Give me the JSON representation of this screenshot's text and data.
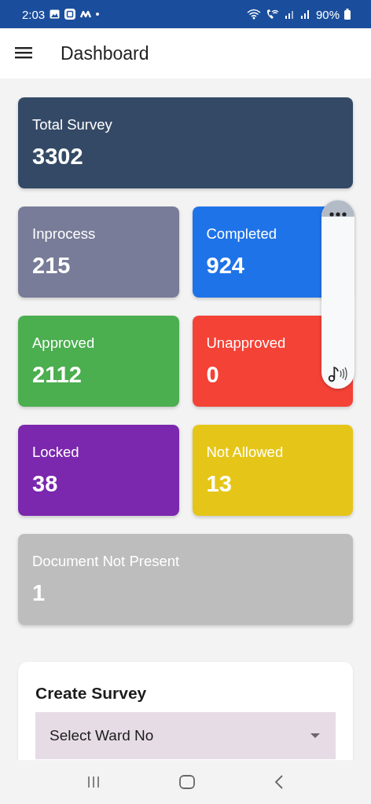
{
  "status_bar": {
    "time": "2:03",
    "battery": "90%"
  },
  "app_bar": {
    "title": "Dashboard"
  },
  "stat_cards": [
    {
      "label": "Total Survey",
      "value": "3302",
      "color": "#344966",
      "kind": "wide"
    },
    {
      "label": "Inprocess",
      "value": "215",
      "color": "#787c98",
      "kind": "half"
    },
    {
      "label": "Completed",
      "value": "924",
      "color": "#1f73e8",
      "kind": "half"
    },
    {
      "label": "Approved",
      "value": "2112",
      "color": "#4bae4f",
      "kind": "half"
    },
    {
      "label": "Unapproved",
      "value": "0",
      "color": "#f44236",
      "kind": "half"
    },
    {
      "label": "Locked",
      "value": "38",
      "color": "#7b27ae",
      "kind": "half"
    },
    {
      "label": "Not Allowed",
      "value": "13",
      "color": "#e5c618",
      "kind": "half"
    },
    {
      "label": "Document Not Present",
      "value": "1",
      "color": "#bdbdbd",
      "kind": "wide"
    }
  ],
  "create_survey": {
    "title": "Create Survey",
    "ward_select": {
      "placeholder": "Select Ward No"
    }
  }
}
